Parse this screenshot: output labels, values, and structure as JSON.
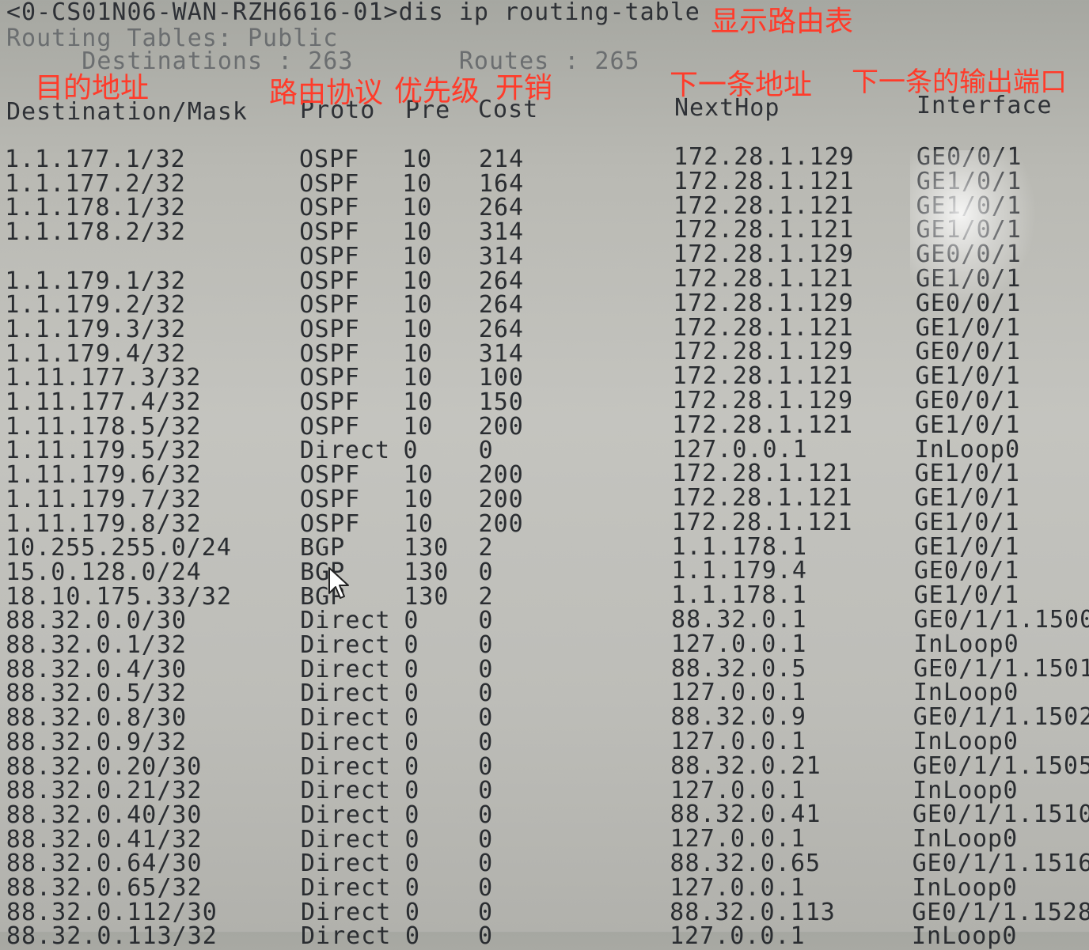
{
  "terminal": {
    "command_line": "<0-CS01N06-WAN-RZH6616-01>dis ip routing-table",
    "routing_tables_line": "Routing Tables: Public",
    "destinations_line": "     Destinations : 263       Routes : 265",
    "headers": {
      "destination": "Destination/Mask",
      "proto": "Proto",
      "pre": "Pre",
      "cost": "Cost",
      "nexthop": "NextHop",
      "interface": "Interface"
    }
  },
  "annotations": {
    "show_table": "显示路由表",
    "destination": "目的地址",
    "protocol": "路由协议",
    "priority": "优先级",
    "cost": "开销",
    "next_hop": "下一条地址",
    "out_interface": "下一条的输出端口"
  },
  "colors": {
    "annotation": "#ff3b2a",
    "text": "#2a2d31",
    "screen": "#c4c4bf"
  },
  "routes": [
    {
      "dest": "1.1.177.1/32",
      "proto": "OSPF",
      "pre": "10",
      "cost": "214",
      "nexthop": "172.28.1.129",
      "iface": "GE0/0/1"
    },
    {
      "dest": "1.1.177.2/32",
      "proto": "OSPF",
      "pre": "10",
      "cost": "164",
      "nexthop": "172.28.1.121",
      "iface": "GE1/0/1"
    },
    {
      "dest": "1.1.178.1/32",
      "proto": "OSPF",
      "pre": "10",
      "cost": "264",
      "nexthop": "172.28.1.121",
      "iface": "GE1/0/1"
    },
    {
      "dest": "1.1.178.2/32",
      "proto": "OSPF",
      "pre": "10",
      "cost": "314",
      "nexthop": "172.28.1.121",
      "iface": "GE1/0/1"
    },
    {
      "dest": "",
      "proto": "OSPF",
      "pre": "10",
      "cost": "314",
      "nexthop": "172.28.1.129",
      "iface": "GE0/0/1"
    },
    {
      "dest": "1.1.179.1/32",
      "proto": "OSPF",
      "pre": "10",
      "cost": "264",
      "nexthop": "172.28.1.121",
      "iface": "GE1/0/1"
    },
    {
      "dest": "1.1.179.2/32",
      "proto": "OSPF",
      "pre": "10",
      "cost": "264",
      "nexthop": "172.28.1.129",
      "iface": "GE0/0/1"
    },
    {
      "dest": "1.1.179.3/32",
      "proto": "OSPF",
      "pre": "10",
      "cost": "264",
      "nexthop": "172.28.1.121",
      "iface": "GE1/0/1"
    },
    {
      "dest": "1.1.179.4/32",
      "proto": "OSPF",
      "pre": "10",
      "cost": "314",
      "nexthop": "172.28.1.129",
      "iface": "GE0/0/1"
    },
    {
      "dest": "1.11.177.3/32",
      "proto": "OSPF",
      "pre": "10",
      "cost": "100",
      "nexthop": "172.28.1.121",
      "iface": "GE1/0/1"
    },
    {
      "dest": "1.11.177.4/32",
      "proto": "OSPF",
      "pre": "10",
      "cost": "150",
      "nexthop": "172.28.1.129",
      "iface": "GE0/0/1"
    },
    {
      "dest": "1.11.178.5/32",
      "proto": "OSPF",
      "pre": "10",
      "cost": "200",
      "nexthop": "172.28.1.121",
      "iface": "GE1/0/1"
    },
    {
      "dest": "1.11.179.5/32",
      "proto": "Direct",
      "pre": "0",
      "cost": "0",
      "nexthop": "127.0.0.1",
      "iface": "InLoop0"
    },
    {
      "dest": "1.11.179.6/32",
      "proto": "OSPF",
      "pre": "10",
      "cost": "200",
      "nexthop": "172.28.1.121",
      "iface": "GE1/0/1"
    },
    {
      "dest": "1.11.179.7/32",
      "proto": "OSPF",
      "pre": "10",
      "cost": "200",
      "nexthop": "172.28.1.121",
      "iface": "GE1/0/1"
    },
    {
      "dest": "1.11.179.8/32",
      "proto": "OSPF",
      "pre": "10",
      "cost": "200",
      "nexthop": "172.28.1.121",
      "iface": "GE1/0/1"
    },
    {
      "dest": "10.255.255.0/24",
      "proto": "BGP",
      "pre": "130",
      "cost": "2",
      "nexthop": "1.1.178.1",
      "iface": "GE1/0/1"
    },
    {
      "dest": "15.0.128.0/24",
      "proto": "BGP",
      "pre": "130",
      "cost": "0",
      "nexthop": "1.1.179.4",
      "iface": "GE0/0/1"
    },
    {
      "dest": "18.10.175.33/32",
      "proto": "BGP",
      "pre": "130",
      "cost": "2",
      "nexthop": "1.1.178.1",
      "iface": "GE1/0/1"
    },
    {
      "dest": "88.32.0.0/30",
      "proto": "Direct",
      "pre": "0",
      "cost": "0",
      "nexthop": "88.32.0.1",
      "iface": "GE0/1/1.1500"
    },
    {
      "dest": "88.32.0.1/32",
      "proto": "Direct",
      "pre": "0",
      "cost": "0",
      "nexthop": "127.0.0.1",
      "iface": "InLoop0"
    },
    {
      "dest": "88.32.0.4/30",
      "proto": "Direct",
      "pre": "0",
      "cost": "0",
      "nexthop": "88.32.0.5",
      "iface": "GE0/1/1.1501"
    },
    {
      "dest": "88.32.0.5/32",
      "proto": "Direct",
      "pre": "0",
      "cost": "0",
      "nexthop": "127.0.0.1",
      "iface": "InLoop0"
    },
    {
      "dest": "88.32.0.8/30",
      "proto": "Direct",
      "pre": "0",
      "cost": "0",
      "nexthop": "88.32.0.9",
      "iface": "GE0/1/1.1502"
    },
    {
      "dest": "88.32.0.9/32",
      "proto": "Direct",
      "pre": "0",
      "cost": "0",
      "nexthop": "127.0.0.1",
      "iface": "InLoop0"
    },
    {
      "dest": "88.32.0.20/30",
      "proto": "Direct",
      "pre": "0",
      "cost": "0",
      "nexthop": "88.32.0.21",
      "iface": "GE0/1/1.1505"
    },
    {
      "dest": "88.32.0.21/32",
      "proto": "Direct",
      "pre": "0",
      "cost": "0",
      "nexthop": "127.0.0.1",
      "iface": "InLoop0"
    },
    {
      "dest": "88.32.0.40/30",
      "proto": "Direct",
      "pre": "0",
      "cost": "0",
      "nexthop": "88.32.0.41",
      "iface": "GE0/1/1.1510"
    },
    {
      "dest": "88.32.0.41/32",
      "proto": "Direct",
      "pre": "0",
      "cost": "0",
      "nexthop": "127.0.0.1",
      "iface": "InLoop0"
    },
    {
      "dest": "88.32.0.64/30",
      "proto": "Direct",
      "pre": "0",
      "cost": "0",
      "nexthop": "88.32.0.65",
      "iface": "GE0/1/1.1516"
    },
    {
      "dest": "88.32.0.65/32",
      "proto": "Direct",
      "pre": "0",
      "cost": "0",
      "nexthop": "127.0.0.1",
      "iface": "InLoop0"
    },
    {
      "dest": "88.32.0.112/30",
      "proto": "Direct",
      "pre": "0",
      "cost": "0",
      "nexthop": "88.32.0.113",
      "iface": "GE0/1/1.1528"
    },
    {
      "dest": "88.32.0.113/32",
      "proto": "Direct",
      "pre": "0",
      "cost": "0",
      "nexthop": "127.0.0.1",
      "iface": "InLoop0"
    }
  ]
}
